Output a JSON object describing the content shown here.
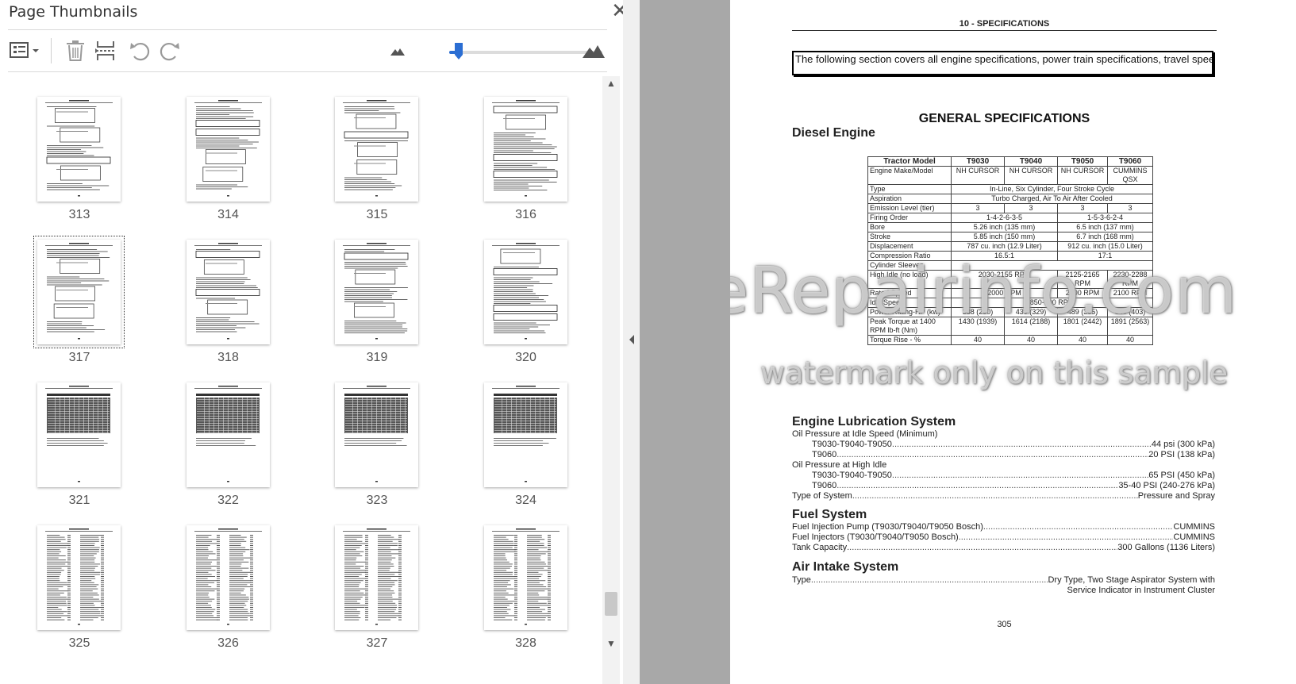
{
  "panel": {
    "title": "Page Thumbnails",
    "close_glyph": "✕",
    "toolbar": {
      "options_icon": "page-options-icon",
      "delete_icon": "trash-icon",
      "insert_icon": "insert-page-icon",
      "undo_icon": "rotate-left-icon",
      "redo_icon": "rotate-right-icon",
      "zoom_out_icon": "small-mountain-icon",
      "zoom_in_icon": "large-mountain-icon",
      "zoom_level": 0.06
    },
    "thumbnails": [
      {
        "label": "313"
      },
      {
        "label": "314"
      },
      {
        "label": "315"
      },
      {
        "label": "316"
      },
      {
        "label": "317",
        "selected": true
      },
      {
        "label": "318"
      },
      {
        "label": "319"
      },
      {
        "label": "320"
      },
      {
        "label": "321"
      },
      {
        "label": "322"
      },
      {
        "label": "323"
      },
      {
        "label": "324"
      },
      {
        "label": "325"
      },
      {
        "label": "326"
      },
      {
        "label": "327"
      },
      {
        "label": "328"
      }
    ],
    "scroll_position": 0.96
  },
  "document": {
    "header": "10 - SPECIFICATIONS",
    "intro": "The following section covers all engine specifications, power train specifications, travel speeds, weights and dimensions on the tractor.",
    "general_title": "GENERAL SPECIFICATIONS",
    "diesel_title": "Diesel Engine",
    "table": {
      "headers": [
        "Tractor Model",
        "T9030",
        "T9040",
        "T9050",
        "T9060"
      ],
      "rows": [
        {
          "label": "Engine Make/Model",
          "cells": [
            "NH CURSOR",
            "NH CURSOR",
            "NH CURSOR",
            "CUMMINS QSX"
          ]
        },
        {
          "label": "Type",
          "span": "In-Line, Six Cylinder, Four Stroke Cycle"
        },
        {
          "label": "Aspiration",
          "span": "Turbo Charged, Air To Air After Cooled"
        },
        {
          "label": "Emission Level (tier)",
          "cells": [
            "3",
            "3",
            "3",
            "3"
          ]
        },
        {
          "label": "Firing Order",
          "pair": [
            "1-4-2-6-3-5",
            "1-5-3-6-2-4"
          ]
        },
        {
          "label": "Bore",
          "pair": [
            "5.26 inch (135 mm)",
            "6.5 inch (137 mm)"
          ]
        },
        {
          "label": "Stroke",
          "pair": [
            "5.85 inch (150 mm)",
            "6.7 inch (168 mm)"
          ]
        },
        {
          "label": "Displacement",
          "pair": [
            "787 cu. inch (12.9 Liter)",
            "912 cu. inch (15.0 Liter)"
          ]
        },
        {
          "label": "Compression Ratio",
          "pair": [
            "16.5:1",
            "17:1"
          ]
        },
        {
          "label": "Cylinder Sleeves",
          "span": ""
        },
        {
          "label": "High Idle (no load)",
          "triple": [
            "2030-2155 RPM",
            "2125-2165 RPM",
            "2230-2288 RPM"
          ]
        },
        {
          "label": "Rated Speed",
          "triple": [
            "2000 RPM",
            "2000 RPM",
            "2100 RPM"
          ]
        },
        {
          "label": "Idle Speed",
          "span": "850-900 RPM"
        },
        {
          "label": "Power Rating-HP (kw)",
          "cells": [
            "388 (290)",
            "439 (329)",
            "489 (365)",
            "540 (403)"
          ]
        },
        {
          "label": "Peak Torque at 1400 RPM lb-ft (Nm)",
          "cells": [
            "1430 (1939)",
            "1614 (2188)",
            "1801 (2442)",
            "1891 (2563)"
          ]
        },
        {
          "label": "Torque Rise - %",
          "cells": [
            "40",
            "40",
            "40",
            "40"
          ]
        }
      ]
    },
    "lubrication": {
      "title": "Engine Lubrication System",
      "idle_label": "Oil Pressure at Idle Speed (Minimum)",
      "idle_a_label": "T9030-T9040-T9050",
      "idle_a_value": "44 psi (300 kPa)",
      "idle_b_label": "T9060",
      "idle_b_value": "20 PSI (138 kPa)",
      "high_label": "Oil Pressure at High Idle",
      "high_a_label": "T9030-T9040-T9050",
      "high_a_value": "65 PSI (450 kPa)",
      "high_b_label": "T9060",
      "high_b_value": "35-40 PSI (240-276 kPa)",
      "type_label": "Type of System",
      "type_value": "Pressure and Spray"
    },
    "fuel": {
      "title": "Fuel System",
      "pump_label": "Fuel Injection Pump (T9030/T9040/T9050 Bosch)",
      "pump_value": "CUMMINS",
      "inj_label": "Fuel Injectors (T9030/T9040/T9050 Bosch)",
      "inj_value": "CUMMINS",
      "tank_label": "Tank Capacity",
      "tank_value": "300 Gallons (1136 Liters)"
    },
    "air": {
      "title": "Air Intake System",
      "type_label": "Type",
      "type_value": "Dry Type, Two Stage Aspirator System with",
      "type_value2": "Service Indicator in Instrument Cluster"
    },
    "page_number": "305",
    "watermark_main": "eRepairinfo.com",
    "watermark_sub": "watermark only on this sample"
  }
}
